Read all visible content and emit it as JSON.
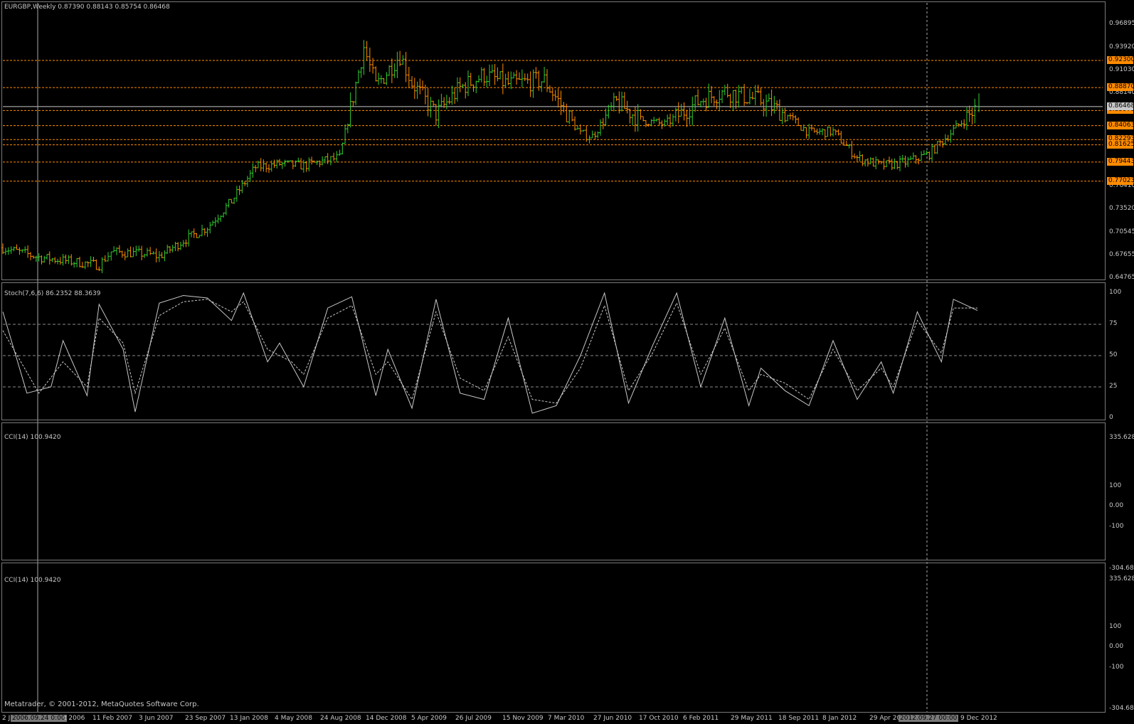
{
  "chart_title": "EURGBP,Weekly  0.87390 0.88143 0.85754 0.86468",
  "footer": "Metatrader, © 2001-2012, MetaQuotes Software Corp.",
  "colors": {
    "bull": "#32cd32",
    "bear": "#ff8c00",
    "level": "#ff8c00",
    "indicator": "#c8c8c8",
    "background": "#000000"
  },
  "price_axis": [
    "0.96895",
    "0.93920",
    "0.91030",
    "0.88140",
    "0.76410",
    "0.73520",
    "0.70545",
    "0.67655",
    "0.64765"
  ],
  "levels": [
    {
      "label": "0.92300",
      "value": 0.923
    },
    {
      "label": "0.88870",
      "value": 0.8887
    },
    {
      "label": "0.85973",
      "value": 0.85973
    },
    {
      "label": "0.84063",
      "value": 0.84063
    },
    {
      "label": "0.82293",
      "value": 0.82293
    },
    {
      "label": "0.81625",
      "value": 0.81625
    },
    {
      "label": "0.79443",
      "value": 0.79443
    },
    {
      "label": "0.77023",
      "value": 0.77023
    }
  ],
  "current_price": {
    "label": "0.86468",
    "value": 0.86468
  },
  "stoch": {
    "title": "Stoch(7,6,6) 86.2352 88.3639",
    "axis": [
      "100",
      "75",
      "50",
      "25",
      "0"
    ],
    "levels": [
      75,
      50,
      25
    ]
  },
  "cci1": {
    "title": "CCI(14) 100.9420",
    "axis": [
      "335.628",
      "100",
      "0.00",
      "-100",
      "-304.680"
    ]
  },
  "cci2": {
    "title": "CCI(14) 100.9420",
    "axis": [
      "335.628",
      "100",
      "0.00",
      "-100",
      "-304.680"
    ]
  },
  "time_axis": [
    "11 Feb 2007",
    "3 Jun 2007",
    "23 Sep 2007",
    "13 Jan 2008",
    "4 May 2008",
    "24 Aug 2008",
    "14 Dec 2008",
    "5 Apr 2009",
    "26 Jul 2009",
    "15 Nov 2009",
    "7 Mar 2010",
    "27 Jun 2010",
    "17 Oct 2010",
    "6 Feb 2011",
    "29 May 2011",
    "18 Sep 2011",
    "8 Jan 2012",
    "29 Apr 2012",
    "9 Dec 2012"
  ],
  "crosshair": {
    "left_label": "2006.09.24 0:00",
    "right_label": "2012.09.27 00:00"
  },
  "axis_fragments": {
    "first": "2 J",
    "after_left": "t 2006"
  },
  "chart_data": {
    "type": "candlestick",
    "symbol": "EURGBP",
    "timeframe": "Weekly",
    "last_bar": {
      "open": 0.8739,
      "high": 0.88143,
      "low": 0.85754,
      "close": 0.86468
    },
    "ylim": [
      0.64765,
      0.98
    ],
    "close_path": [
      [
        "2006-06",
        0.686
      ],
      [
        "2006-09",
        0.674
      ],
      [
        "2006-11",
        0.67
      ],
      [
        "2007-02",
        0.664
      ],
      [
        "2007-03",
        0.681
      ],
      [
        "2007-06",
        0.678
      ],
      [
        "2007-07",
        0.675
      ],
      [
        "2007-09",
        0.695
      ],
      [
        "2007-11",
        0.712
      ],
      [
        "2008-01",
        0.745
      ],
      [
        "2008-03",
        0.788
      ],
      [
        "2008-05",
        0.792
      ],
      [
        "2008-07",
        0.79
      ],
      [
        "2008-09",
        0.797
      ],
      [
        "2008-10",
        0.8
      ],
      [
        "2008-12",
        0.94
      ],
      [
        "2009-01",
        0.89
      ],
      [
        "2009-03",
        0.93
      ],
      [
        "2009-04",
        0.895
      ],
      [
        "2009-06",
        0.855
      ],
      [
        "2009-08",
        0.888
      ],
      [
        "2009-10",
        0.905
      ],
      [
        "2009-12",
        0.893
      ],
      [
        "2010-03",
        0.898
      ],
      [
        "2010-06",
        0.83
      ],
      [
        "2010-07",
        0.827
      ],
      [
        "2010-09",
        0.87
      ],
      [
        "2010-11",
        0.848
      ],
      [
        "2011-01",
        0.842
      ],
      [
        "2011-04",
        0.873
      ],
      [
        "2011-06",
        0.884
      ],
      [
        "2011-09",
        0.872
      ],
      [
        "2011-11",
        0.855
      ],
      [
        "2012-01",
        0.832
      ],
      [
        "2012-03",
        0.833
      ],
      [
        "2012-05",
        0.8
      ],
      [
        "2012-07",
        0.79
      ],
      [
        "2012-09",
        0.794
      ],
      [
        "2012-11",
        0.805
      ],
      [
        "2013-01",
        0.835
      ],
      [
        "2013-03",
        0.864
      ]
    ],
    "stoch_main": [
      [
        "2006-06",
        85
      ],
      [
        "2006-08",
        20
      ],
      [
        "2006-10",
        25
      ],
      [
        "2006-11",
        62
      ],
      [
        "2007-01",
        18
      ],
      [
        "2007-02",
        91
      ],
      [
        "2007-04",
        55
      ],
      [
        "2007-05",
        5
      ],
      [
        "2007-07",
        92
      ],
      [
        "2007-09",
        98
      ],
      [
        "2007-11",
        96
      ],
      [
        "2008-01",
        78
      ],
      [
        "2008-02",
        100
      ],
      [
        "2008-04",
        45
      ],
      [
        "2008-05",
        60
      ],
      [
        "2008-07",
        25
      ],
      [
        "2008-09",
        88
      ],
      [
        "2008-11",
        97
      ],
      [
        "2009-01",
        18
      ],
      [
        "2009-02",
        55
      ],
      [
        "2009-04",
        8
      ],
      [
        "2009-06",
        95
      ],
      [
        "2009-08",
        20
      ],
      [
        "2009-10",
        15
      ],
      [
        "2009-12",
        80
      ],
      [
        "2010-02",
        4
      ],
      [
        "2010-04",
        10
      ],
      [
        "2010-06",
        50
      ],
      [
        "2010-08",
        100
      ],
      [
        "2010-10",
        12
      ],
      [
        "2010-12",
        58
      ],
      [
        "2011-02",
        100
      ],
      [
        "2011-04",
        25
      ],
      [
        "2011-06",
        80
      ],
      [
        "2011-08",
        10
      ],
      [
        "2011-09",
        40
      ],
      [
        "2011-11",
        22
      ],
      [
        "2012-01",
        10
      ],
      [
        "2012-03",
        62
      ],
      [
        "2012-05",
        15
      ],
      [
        "2012-07",
        45
      ],
      [
        "2012-08",
        20
      ],
      [
        "2012-10",
        85
      ],
      [
        "2012-12",
        45
      ],
      [
        "2013-01",
        95
      ],
      [
        "2013-03",
        86
      ]
    ],
    "stoch_signal": [
      [
        "2006-06",
        70
      ],
      [
        "2006-09",
        20
      ],
      [
        "2006-11",
        45
      ],
      [
        "2007-01",
        25
      ],
      [
        "2007-02",
        80
      ],
      [
        "2007-04",
        60
      ],
      [
        "2007-05",
        20
      ],
      [
        "2007-07",
        82
      ],
      [
        "2007-09",
        93
      ],
      [
        "2007-11",
        95
      ],
      [
        "2008-01",
        85
      ],
      [
        "2008-02",
        93
      ],
      [
        "2008-04",
        55
      ],
      [
        "2008-06",
        45
      ],
      [
        "2008-07",
        35
      ],
      [
        "2008-09",
        80
      ],
      [
        "2008-11",
        90
      ],
      [
        "2009-01",
        35
      ],
      [
        "2009-02",
        45
      ],
      [
        "2009-04",
        15
      ],
      [
        "2009-06",
        85
      ],
      [
        "2009-08",
        32
      ],
      [
        "2009-10",
        22
      ],
      [
        "2009-12",
        65
      ],
      [
        "2010-02",
        15
      ],
      [
        "2010-04",
        12
      ],
      [
        "2010-06",
        40
      ],
      [
        "2010-08",
        90
      ],
      [
        "2010-10",
        22
      ],
      [
        "2010-12",
        52
      ],
      [
        "2011-02",
        92
      ],
      [
        "2011-04",
        35
      ],
      [
        "2011-06",
        72
      ],
      [
        "2011-08",
        22
      ],
      [
        "2011-09",
        35
      ],
      [
        "2011-11",
        28
      ],
      [
        "2012-01",
        15
      ],
      [
        "2012-03",
        55
      ],
      [
        "2012-05",
        22
      ],
      [
        "2012-07",
        40
      ],
      [
        "2012-08",
        25
      ],
      [
        "2012-10",
        78
      ],
      [
        "2012-12",
        52
      ],
      [
        "2013-01",
        88
      ],
      [
        "2013-03",
        88
      ]
    ]
  }
}
